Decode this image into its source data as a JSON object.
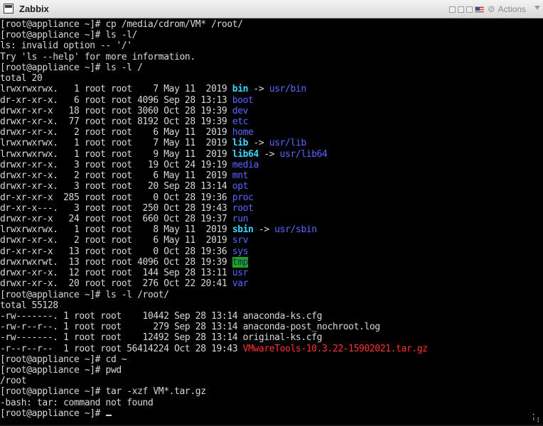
{
  "window": {
    "title": "Zabbix",
    "actions_label": "Actions",
    "icons": [
      "monitor-icon",
      "window-controls",
      "flag-icon",
      "gear-icon",
      "chevron-down-icon"
    ]
  },
  "terminal": {
    "fg": "#d8d8d8",
    "bg": "#000000",
    "lines": [
      [
        {
          "t": "[root@appliance ~]# cp /media/cdrom/VM* /root/"
        }
      ],
      [
        {
          "t": "[root@appliance ~]# ls -l/"
        }
      ],
      [
        {
          "t": "ls: invalid option -- '/'"
        }
      ],
      [
        {
          "t": "Try 'ls --help' for more information."
        }
      ],
      [
        {
          "t": "[root@appliance ~]# ls -l /"
        }
      ],
      [
        {
          "t": "total 20"
        }
      ],
      [
        {
          "t": "lrwxrwxrwx.   1 root root    7 May 11  2019 "
        },
        {
          "t": "bin",
          "c": "lnk"
        },
        {
          "t": " -> "
        },
        {
          "t": "usr/bin",
          "c": "dir"
        }
      ],
      [
        {
          "t": "dr-xr-xr-x.   6 root root 4096 Sep 28 13:13 "
        },
        {
          "t": "boot",
          "c": "dir"
        }
      ],
      [
        {
          "t": "drwxr-xr-x   18 root root 3060 Oct 28 19:39 "
        },
        {
          "t": "dev",
          "c": "dir"
        }
      ],
      [
        {
          "t": "drwxr-xr-x.  77 root root 8192 Oct 28 19:39 "
        },
        {
          "t": "etc",
          "c": "dir"
        }
      ],
      [
        {
          "t": "drwxr-xr-x.   2 root root    6 May 11  2019 "
        },
        {
          "t": "home",
          "c": "dir"
        }
      ],
      [
        {
          "t": "lrwxrwxrwx.   1 root root    7 May 11  2019 "
        },
        {
          "t": "lib",
          "c": "lnk"
        },
        {
          "t": " -> "
        },
        {
          "t": "usr/lib",
          "c": "dir"
        }
      ],
      [
        {
          "t": "lrwxrwxrwx.   1 root root    9 May 11  2019 "
        },
        {
          "t": "lib64",
          "c": "lnk"
        },
        {
          "t": " -> "
        },
        {
          "t": "usr/lib64",
          "c": "dir"
        }
      ],
      [
        {
          "t": "drwxr-xr-x.   3 root root   19 Oct 24 19:19 "
        },
        {
          "t": "media",
          "c": "dir"
        }
      ],
      [
        {
          "t": "drwxr-xr-x.   2 root root    6 May 11  2019 "
        },
        {
          "t": "mnt",
          "c": "dir"
        }
      ],
      [
        {
          "t": "drwxr-xr-x.   3 root root   20 Sep 28 13:14 "
        },
        {
          "t": "opt",
          "c": "dir"
        }
      ],
      [
        {
          "t": "dr-xr-xr-x  285 root root    0 Oct 28 19:36 "
        },
        {
          "t": "proc",
          "c": "dir"
        }
      ],
      [
        {
          "t": "dr-xr-x---.   3 root root  250 Oct 28 19:43 "
        },
        {
          "t": "root",
          "c": "dir"
        }
      ],
      [
        {
          "t": "drwxr-xr-x   24 root root  660 Oct 28 19:37 "
        },
        {
          "t": "run",
          "c": "dir"
        }
      ],
      [
        {
          "t": "lrwxrwxrwx.   1 root root    8 May 11  2019 "
        },
        {
          "t": "sbin",
          "c": "lnk"
        },
        {
          "t": " -> "
        },
        {
          "t": "usr/sbin",
          "c": "dir"
        }
      ],
      [
        {
          "t": "drwxr-xr-x.   2 root root    6 May 11  2019 "
        },
        {
          "t": "srv",
          "c": "dir"
        }
      ],
      [
        {
          "t": "dr-xr-xr-x   13 root root    0 Oct 28 19:36 "
        },
        {
          "t": "sys",
          "c": "dir"
        }
      ],
      [
        {
          "t": "drwxrwxrwt.  13 root root 4096 Oct 28 19:39 "
        },
        {
          "t": "tmp",
          "c": "hl"
        }
      ],
      [
        {
          "t": "drwxr-xr-x.  12 root root  144 Sep 28 13:11 "
        },
        {
          "t": "usr",
          "c": "dir"
        }
      ],
      [
        {
          "t": "drwxr-xr-x.  20 root root  276 Oct 22 20:41 "
        },
        {
          "t": "var",
          "c": "dir"
        }
      ],
      [
        {
          "t": "[root@appliance ~]# ls -l /root/"
        }
      ],
      [
        {
          "t": "total 55128"
        }
      ],
      [
        {
          "t": "-rw-------. 1 root root    10442 Sep 28 13:14 anaconda-ks.cfg"
        }
      ],
      [
        {
          "t": "-rw-r--r--. 1 root root      279 Sep 28 13:14 anaconda-post_nochroot.log"
        }
      ],
      [
        {
          "t": "-rw-------. 1 root root    12492 Sep 28 13:14 original-ks.cfg"
        }
      ],
      [
        {
          "t": "-r--r--r--  1 root root 56414224 Oct 28 19:43 "
        },
        {
          "t": "VMwareTools-10.3.22-15902021.tar.gz",
          "c": "red"
        }
      ],
      [
        {
          "t": "[root@appliance ~]# cd ~"
        }
      ],
      [
        {
          "t": "[root@appliance ~]# pwd"
        }
      ],
      [
        {
          "t": "/root"
        }
      ],
      [
        {
          "t": "[root@appliance ~]# tar -xzf VM*.tar.gz"
        }
      ],
      [
        {
          "t": "-bash: tar: command not found"
        }
      ],
      [
        {
          "t": "[root@appliance ~]# "
        },
        {
          "cursor": true
        }
      ]
    ]
  }
}
